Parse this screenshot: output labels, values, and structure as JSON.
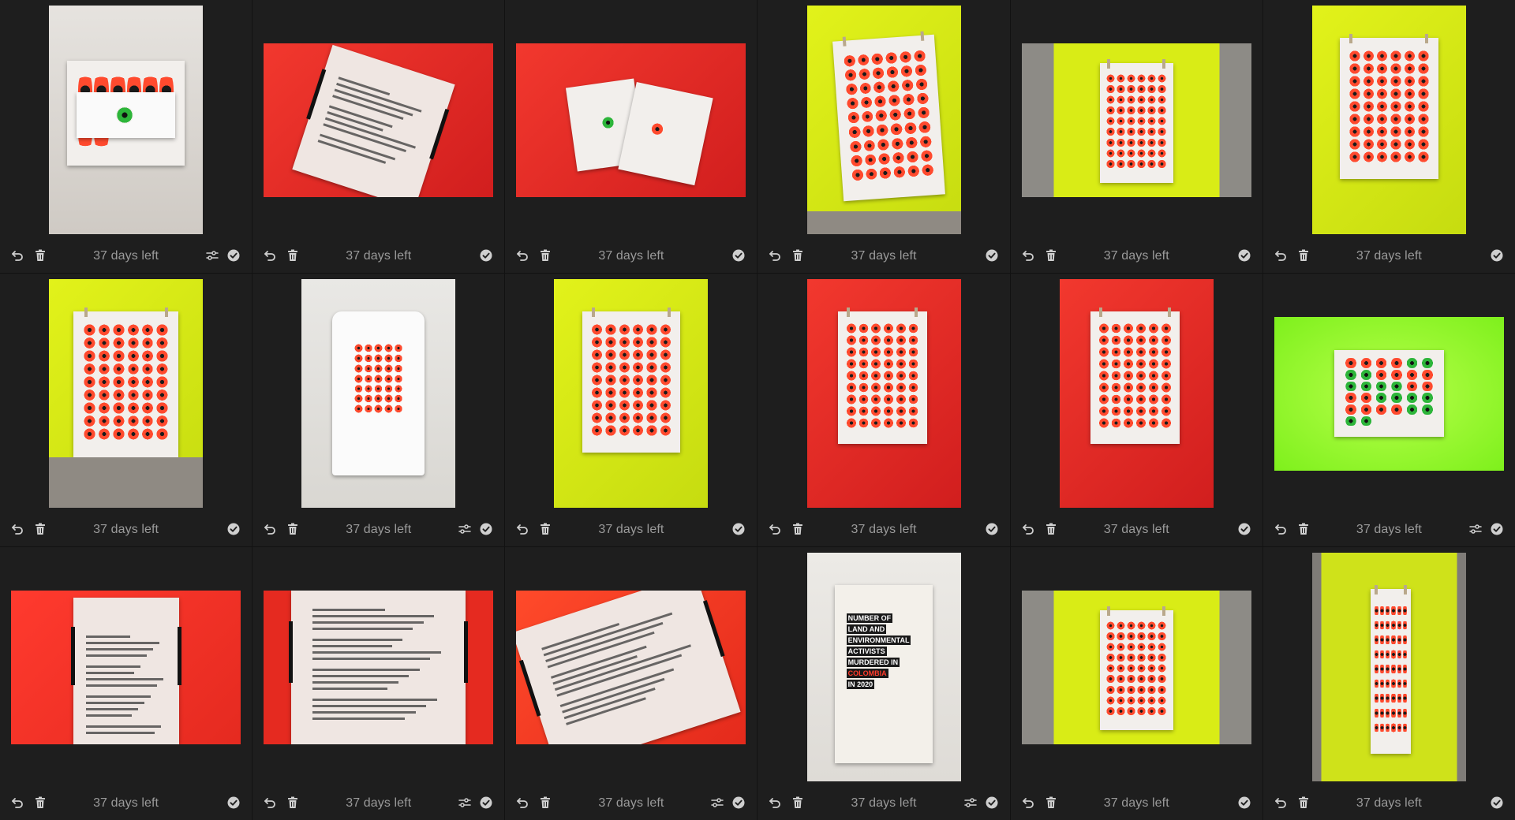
{
  "colors": {
    "background": "#1d1d1d",
    "cell_background": "#1e1e1e",
    "icon": "#cfcfcf",
    "label": "#9a9a9a",
    "accent_red": "#ff4a2e",
    "accent_yellow_green": "#d6ea14"
  },
  "icons": {
    "undo": "undo-icon",
    "delete": "trash-icon",
    "edited": "adjustments-icon",
    "select": "checkmark-circle-icon"
  },
  "tiles": [
    {
      "days_left": "37 days left",
      "edited": true,
      "scene": "sticker-sheet-white"
    },
    {
      "days_left": "37 days left",
      "edited": false,
      "scene": "backcard-on-red"
    },
    {
      "days_left": "37 days left",
      "edited": false,
      "scene": "two-cards-on-red"
    },
    {
      "days_left": "37 days left",
      "edited": false,
      "scene": "poster-on-yellow-angled"
    },
    {
      "days_left": "37 days left",
      "edited": false,
      "scene": "poster-on-yellow-wide"
    },
    {
      "days_left": "37 days left",
      "edited": false,
      "scene": "poster-on-yellow"
    },
    {
      "days_left": "37 days left",
      "edited": false,
      "scene": "poster-on-yellow-floor"
    },
    {
      "days_left": "37 days left",
      "edited": true,
      "scene": "tshirt-on-white"
    },
    {
      "days_left": "37 days left",
      "edited": false,
      "scene": "poster-on-yellow"
    },
    {
      "days_left": "37 days left",
      "edited": false,
      "scene": "poster-on-red"
    },
    {
      "days_left": "37 days left",
      "edited": false,
      "scene": "poster-on-red"
    },
    {
      "days_left": "37 days left",
      "edited": true,
      "scene": "sticker-sheet-on-green"
    },
    {
      "days_left": "37 days left",
      "edited": false,
      "scene": "text-card-on-red"
    },
    {
      "days_left": "37 days left",
      "edited": true,
      "scene": "text-card-closeup-on-red"
    },
    {
      "days_left": "37 days left",
      "edited": true,
      "scene": "text-card-angled-on-red"
    },
    {
      "days_left": "37 days left",
      "edited": true,
      "scene": "tote-bag",
      "tote_text": [
        "NUMBER OF",
        "LAND AND",
        "ENVIRONMENTAL",
        "ACTIVISTS",
        "MURDERED IN",
        "COLOMBIA",
        "IN 2020"
      ]
    },
    {
      "days_left": "37 days left",
      "edited": false,
      "scene": "poster-on-yellow-wide"
    },
    {
      "days_left": "37 days left",
      "edited": false,
      "scene": "poster-on-yellow-wall"
    }
  ]
}
